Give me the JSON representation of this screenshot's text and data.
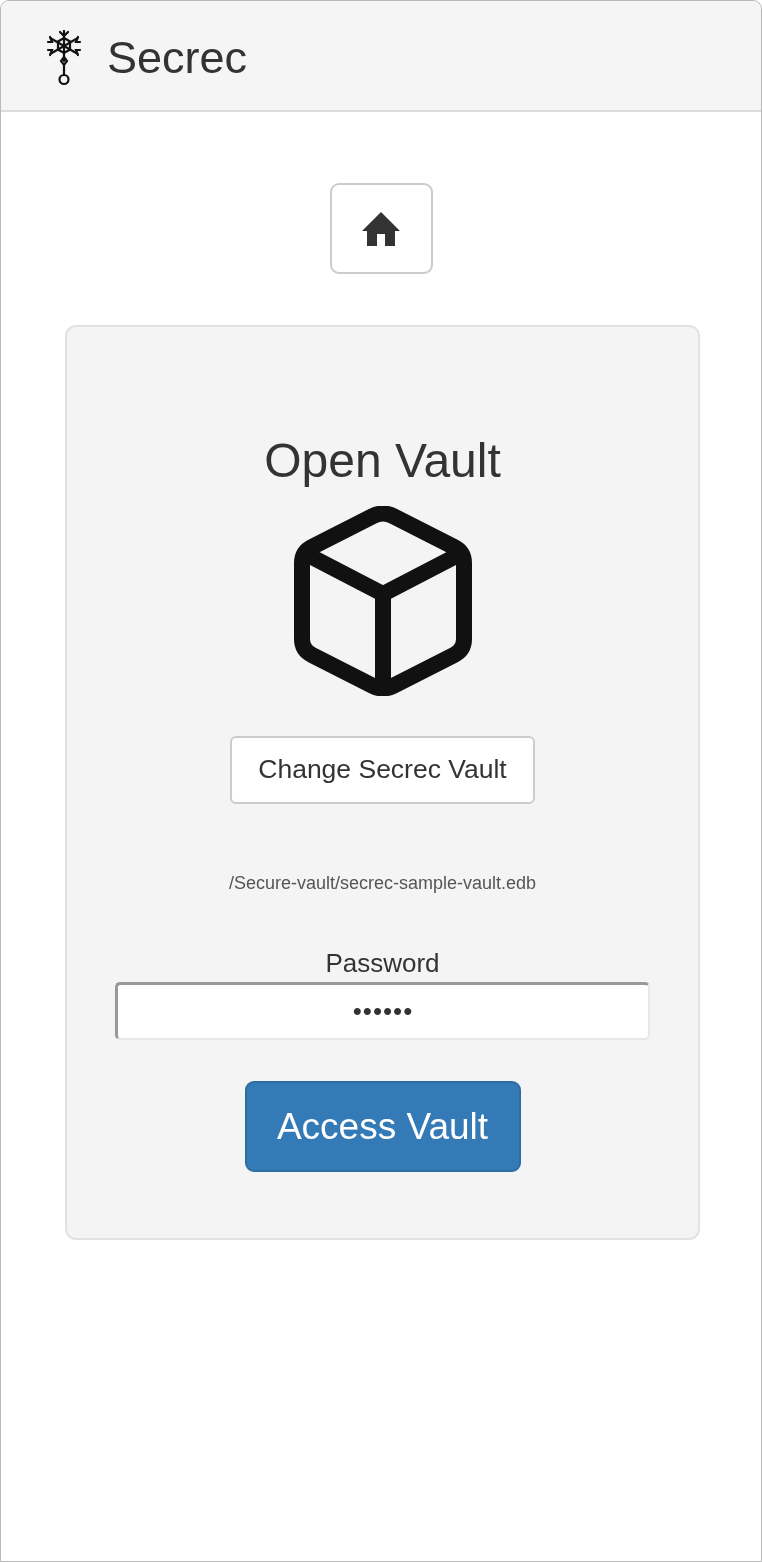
{
  "app": {
    "title": "Secrec"
  },
  "vault": {
    "title": "Open Vault",
    "change_button": "Change Secrec Vault",
    "path": "/Secure-vault/secrec-sample-vault.edb",
    "password": {
      "label": "Password",
      "value": "••••••"
    },
    "submit_button": "Access Vault"
  }
}
